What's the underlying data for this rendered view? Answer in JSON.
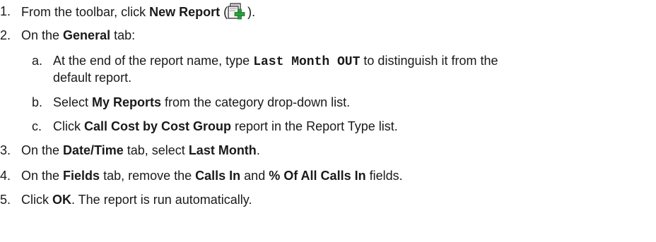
{
  "steps": [
    {
      "number": "1.",
      "text_before": "From the toolbar, click ",
      "bold": "New Report",
      "text_after_open": " (",
      "icon": "new-report-icon",
      "text_after_close": ")."
    },
    {
      "number": "2.",
      "text_before": "On the ",
      "bold": "General",
      "text_after": " tab:"
    },
    {
      "number": "3.",
      "text_before": "On the ",
      "bold": "Date/Time",
      "text_middle": " tab, select ",
      "bold2": "Last Month",
      "text_after": "."
    },
    {
      "number": "4.",
      "text_before": "On the ",
      "bold": "Fields",
      "text_middle": " tab, remove the ",
      "bold2": "Calls In",
      "text_middle2": " and ",
      "bold3": "% Of All Calls In",
      "text_after": " fields."
    },
    {
      "number": "5.",
      "text_before": "Click ",
      "bold": "OK",
      "text_after": ". The report is run automatically."
    }
  ],
  "substeps": [
    {
      "letter": "a.",
      "text_before": "At the end of the report name, type ",
      "code": "Last Month OUT",
      "text_after": " to distinguish it from the",
      "line2": "default report."
    },
    {
      "letter": "b.",
      "text_before": "Select ",
      "bold": "My Reports",
      "text_after": " from the category drop-down list."
    },
    {
      "letter": "c.",
      "text_before": "Click ",
      "bold": "Call Cost by Cost Group",
      "text_after": " report in the Report Type list."
    }
  ],
  "colors": {
    "text": "#1a1a1a",
    "icon_plus": "#2e9e3e",
    "icon_outline": "#333333"
  }
}
